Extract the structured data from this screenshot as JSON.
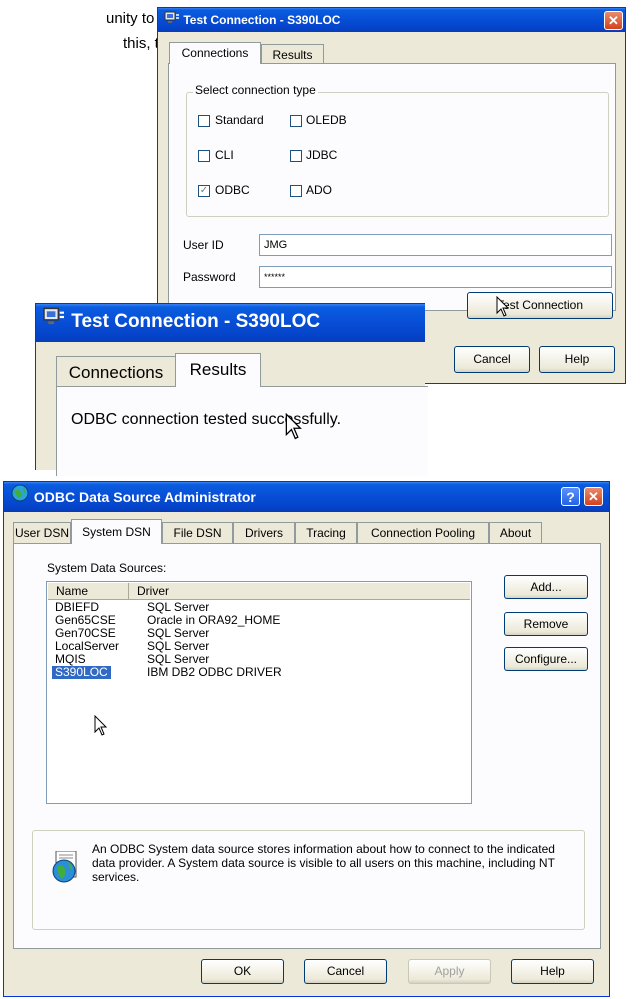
{
  "doc_text": {
    "line1": "unity to test",
    "line2": "this, then"
  },
  "win1": {
    "title": "Test Connection - S390LOC",
    "tabs": [
      "Connections",
      "Results"
    ],
    "group_label": "Select connection type",
    "checkboxes": [
      {
        "label": "Standard",
        "checked": false
      },
      {
        "label": "OLEDB",
        "checked": false
      },
      {
        "label": "CLI",
        "checked": false
      },
      {
        "label": "JDBC",
        "checked": false
      },
      {
        "label": "ODBC",
        "checked": true
      },
      {
        "label": "ADO",
        "checked": false
      }
    ],
    "userid_label": "User ID",
    "userid_value": "JMG",
    "password_label": "Password",
    "password_value": "******",
    "test_button": "Test Connection",
    "cancel_button": "Cancel",
    "help_button": "Help"
  },
  "win2": {
    "title": "Test Connection - S390LOC",
    "tabs": [
      "Connections",
      "Results"
    ],
    "result_text": "ODBC connection tested successfully."
  },
  "win3": {
    "title": "ODBC Data Source Administrator",
    "tabs": [
      "User DSN",
      "System DSN",
      "File DSN",
      "Drivers",
      "Tracing",
      "Connection Pooling",
      "About"
    ],
    "list_label": "System Data Sources:",
    "columns": [
      "Name",
      "Driver"
    ],
    "rows": [
      {
        "name": "DBIEFD",
        "driver": "SQL Server"
      },
      {
        "name": "Gen65CSE",
        "driver": "Oracle in ORA92_HOME"
      },
      {
        "name": "Gen70CSE",
        "driver": "SQL Server"
      },
      {
        "name": "LocalServer",
        "driver": "SQL Server"
      },
      {
        "name": "MQIS",
        "driver": "SQL Server"
      },
      {
        "name": "S390LOC",
        "driver": "IBM DB2 ODBC DRIVER"
      }
    ],
    "selected_row": "S390LOC",
    "side_buttons": [
      "Add...",
      "Remove",
      "Configure..."
    ],
    "info_text": "An ODBC System data source stores information about how to connect to the indicated data provider.  A System data source is visible to all users on this machine, including NT services.",
    "bottom_buttons": [
      "OK",
      "Cancel",
      "Apply",
      "Help"
    ],
    "apply_disabled": true
  }
}
